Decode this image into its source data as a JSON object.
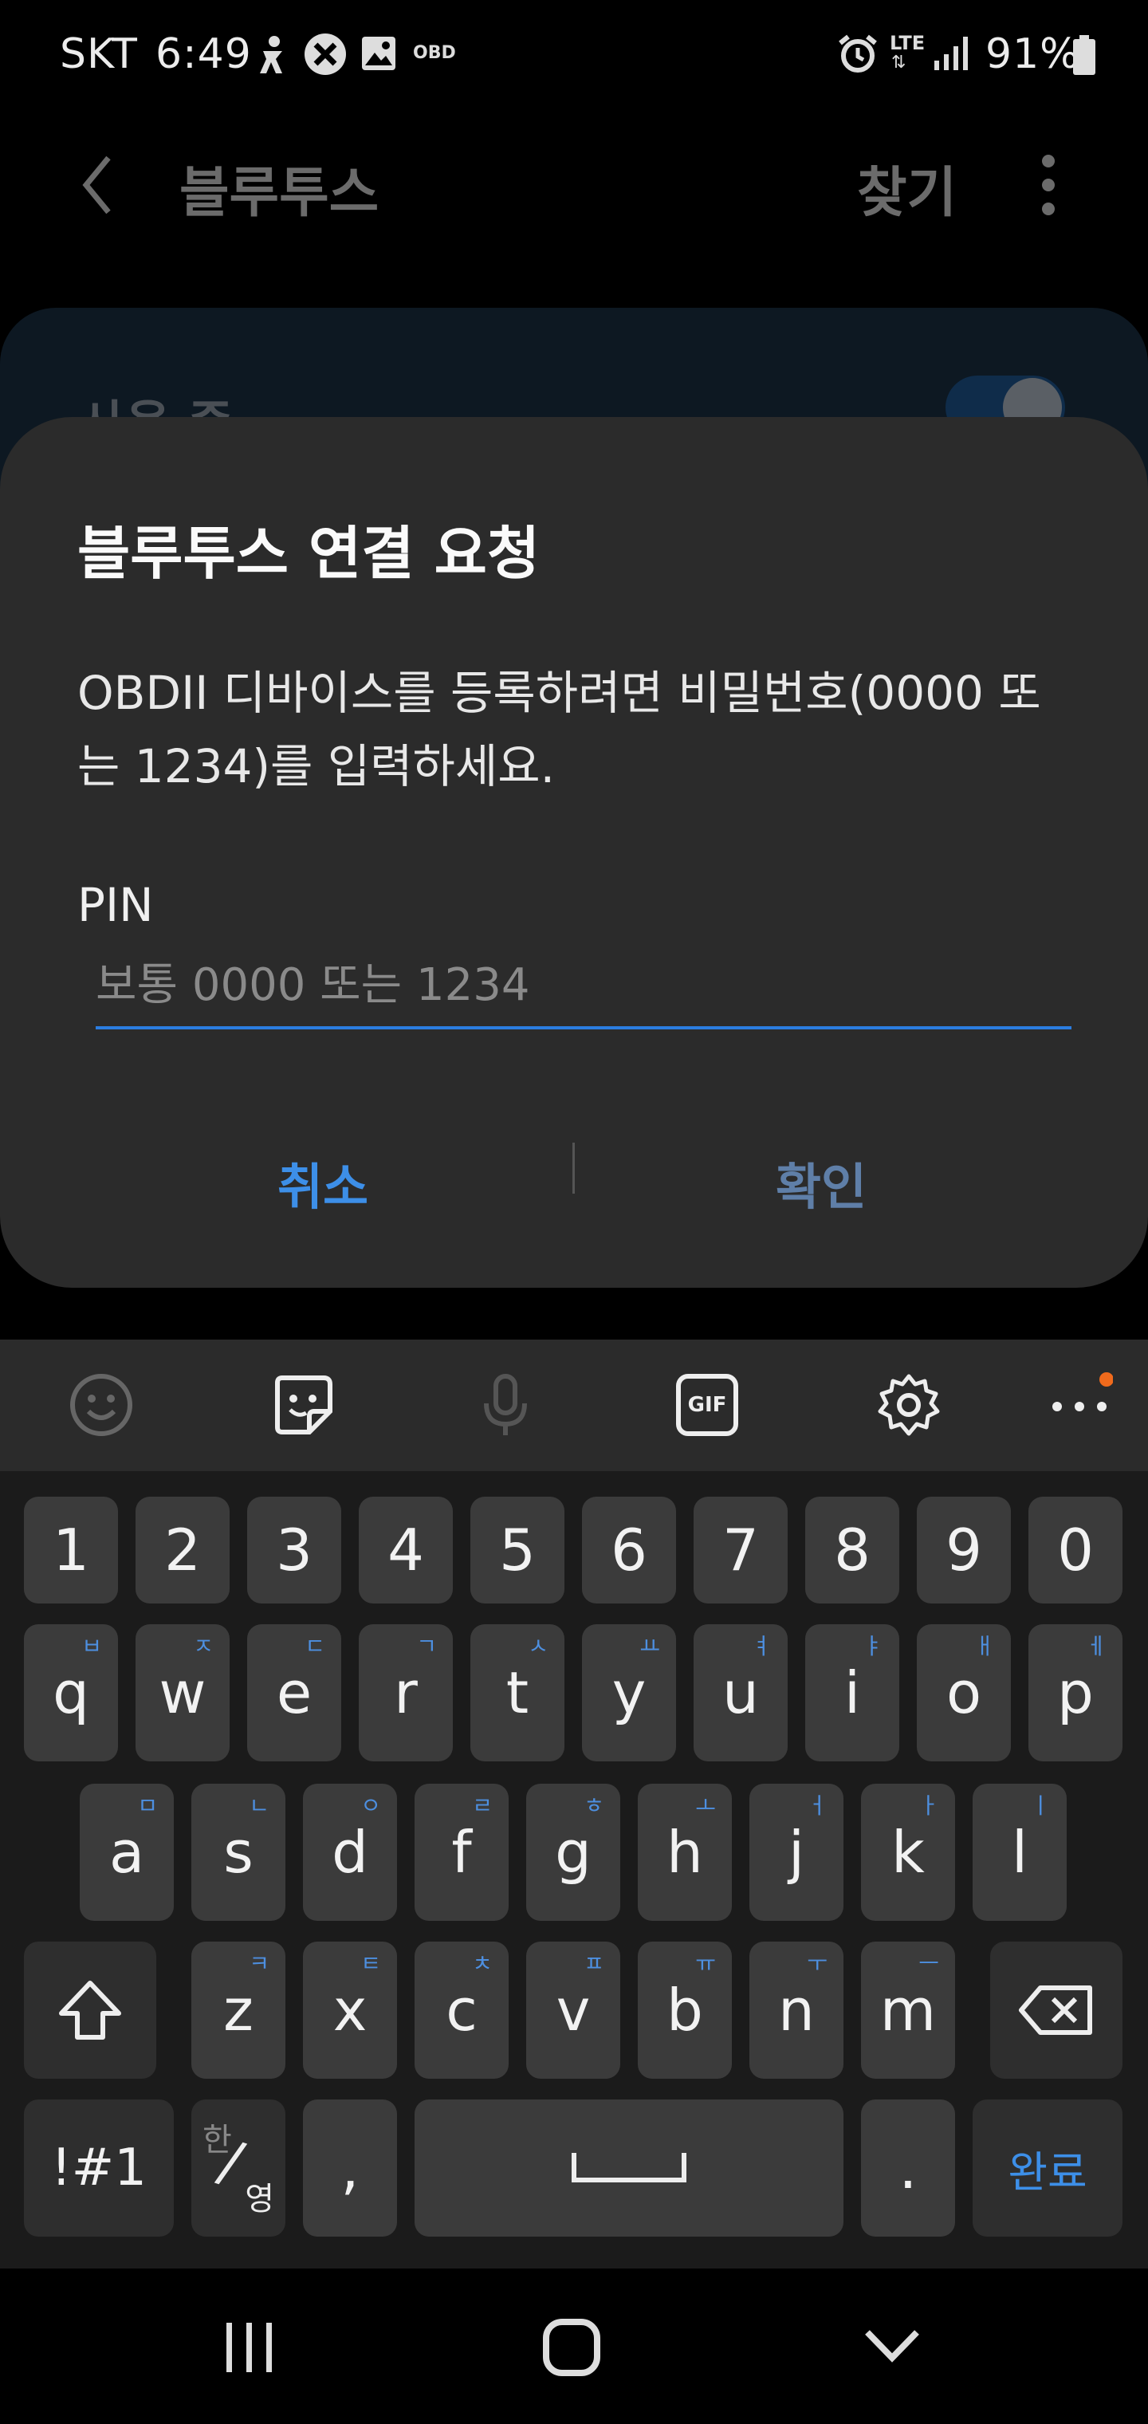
{
  "status_bar": {
    "carrier": "SKT",
    "time": "6:49",
    "notification_icons": [
      "accessibility-icon",
      "blocked-app-icon",
      "image-icon"
    ],
    "obd_label": "OBD",
    "network": "LTE",
    "battery": "91%"
  },
  "background_page": {
    "title": "블루투스",
    "search_label": "찾기",
    "status_label": "사용 중"
  },
  "dialog": {
    "title": "블루투스 연결 요청",
    "message": "OBDII 디바이스를 등록하려면 비밀번호(0000 또는 1234)를 입력하세요.",
    "pin_label": "PIN",
    "pin_value": "",
    "pin_placeholder": "보통 0000 또는 1234",
    "cancel_label": "취소",
    "confirm_label": "확인"
  },
  "keyboard": {
    "toolbar_icons": [
      "emoji-icon",
      "sticker-icon",
      "microphone-icon",
      "gif-icon",
      "settings-icon",
      "more-icon"
    ],
    "gif_label": "GIF",
    "accent_color": "#3d8fe8",
    "number_row": [
      "1",
      "2",
      "3",
      "4",
      "5",
      "6",
      "7",
      "8",
      "9",
      "0"
    ],
    "row1": [
      {
        "key": "q",
        "hint": "ㅂ"
      },
      {
        "key": "w",
        "hint": "ㅈ"
      },
      {
        "key": "e",
        "hint": "ㄷ"
      },
      {
        "key": "r",
        "hint": "ㄱ"
      },
      {
        "key": "t",
        "hint": "ㅅ"
      },
      {
        "key": "y",
        "hint": "ㅛ"
      },
      {
        "key": "u",
        "hint": "ㅕ"
      },
      {
        "key": "i",
        "hint": "ㅑ"
      },
      {
        "key": "o",
        "hint": "ㅐ"
      },
      {
        "key": "p",
        "hint": "ㅔ"
      }
    ],
    "row2": [
      {
        "key": "a",
        "hint": "ㅁ"
      },
      {
        "key": "s",
        "hint": "ㄴ"
      },
      {
        "key": "d",
        "hint": "ㅇ"
      },
      {
        "key": "f",
        "hint": "ㄹ"
      },
      {
        "key": "g",
        "hint": "ㅎ"
      },
      {
        "key": "h",
        "hint": "ㅗ"
      },
      {
        "key": "j",
        "hint": "ㅓ"
      },
      {
        "key": "k",
        "hint": "ㅏ"
      },
      {
        "key": "l",
        "hint": "ㅣ"
      }
    ],
    "row3": [
      {
        "key": "z",
        "hint": "ㅋ"
      },
      {
        "key": "x",
        "hint": "ㅌ"
      },
      {
        "key": "c",
        "hint": "ㅊ"
      },
      {
        "key": "v",
        "hint": "ㅍ"
      },
      {
        "key": "b",
        "hint": "ㅠ"
      },
      {
        "key": "n",
        "hint": "ㅜ"
      },
      {
        "key": "m",
        "hint": "ㅡ"
      }
    ],
    "symbols_label": "!#1",
    "lang_top": "한",
    "lang_bottom": "영",
    "comma": ",",
    "period": ".",
    "done_label": "완료"
  },
  "nav_bar": {
    "icons": [
      "recent-apps-icon",
      "home-icon",
      "hide-keyboard-icon"
    ]
  }
}
